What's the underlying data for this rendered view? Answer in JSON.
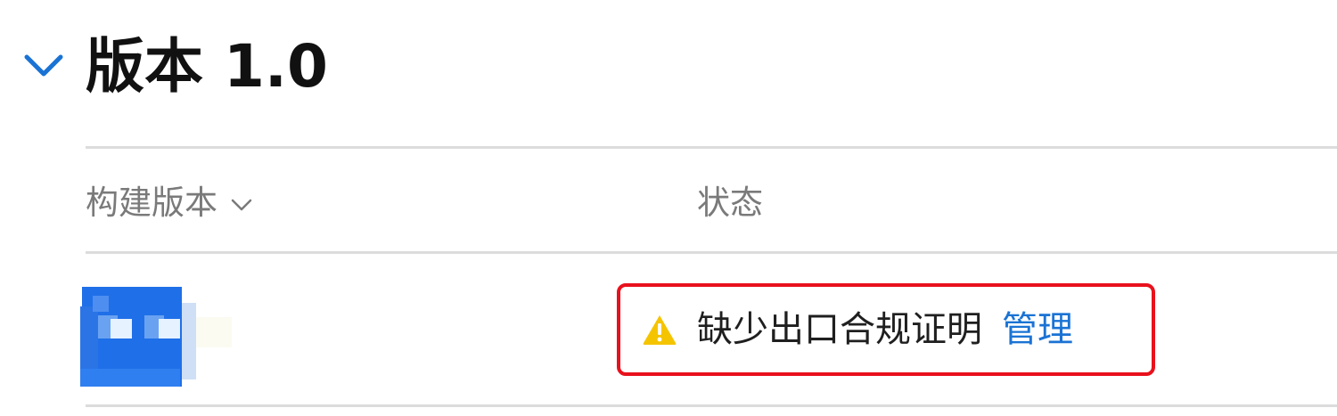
{
  "section": {
    "title": "版本 1.0",
    "expanded": true
  },
  "table": {
    "columns": {
      "build": "构建版本",
      "status": "状态"
    },
    "rows": [
      {
        "build_thumbnail": "blurred-build-icon",
        "status_text": "缺少出口合规证明",
        "action_label": "管理"
      }
    ]
  },
  "colors": {
    "accent_blue": "#1a73d4",
    "highlight_red": "#e8111c",
    "warning_yellow": "#f5c400"
  }
}
